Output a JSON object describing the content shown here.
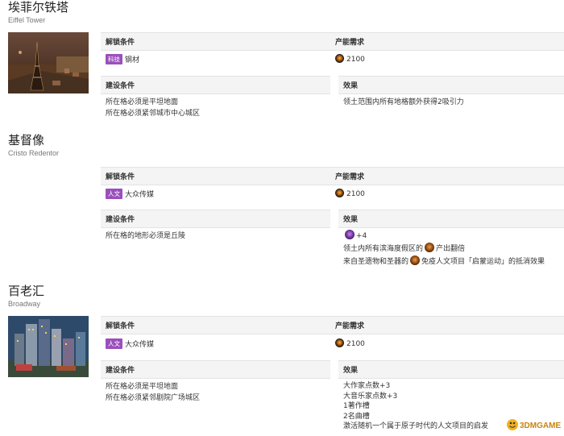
{
  "wonders": [
    {
      "name": "埃菲尔铁塔",
      "english": "Eiffel Tower",
      "unlock_header": "解锁条件",
      "cost_header": "产能需求",
      "unlock_badge": "科技",
      "unlock_value": "钢材",
      "cost_value": "2100",
      "build_header": "建设条件",
      "effect_header": "效果",
      "build_lines": [
        "所在格必须是平坦地面",
        "所在格必须紧邻城市中心城区"
      ],
      "effect_lines": [
        "领土范围内所有地格额外获得2吸引力"
      ]
    },
    {
      "name": "基督像",
      "english": "Cristo Redentor",
      "unlock_header": "解锁条件",
      "cost_header": "产能需求",
      "unlock_badge": "人文",
      "unlock_value": "大众传媒",
      "cost_value": "2100",
      "build_header": "建设条件",
      "effect_header": "效果",
      "build_lines": [
        "所在格的地形必须是丘陵"
      ],
      "effect_faith": "+4",
      "effect_line2_a": "领土内所有滨海度假区的",
      "effect_line2_b": "产出翻倍",
      "effect_line3_a": "来自圣遗物和圣器的",
      "effect_line3_b": "免疫人文项目「启蒙运动」的抵消效果"
    },
    {
      "name": "百老汇",
      "english": "Broadway",
      "unlock_header": "解锁条件",
      "cost_header": "产能需求",
      "unlock_badge": "人文",
      "unlock_value": "大众传媒",
      "cost_value": "2100",
      "build_header": "建设条件",
      "effect_header": "效果",
      "build_lines": [
        "所在格必须是平坦地面",
        "所在格必须紧邻剧院广场城区"
      ],
      "effect_lines": [
        "大作家点数+3",
        "大音乐家点数+3",
        "1著作槽",
        "2名曲槽",
        "激活随机一个属于原子时代的人文项目的启发"
      ]
    }
  ],
  "watermark": "3DMGAME",
  "colors": {
    "badge": "#9b4fbd",
    "header_bg": "#f4f4f4"
  }
}
